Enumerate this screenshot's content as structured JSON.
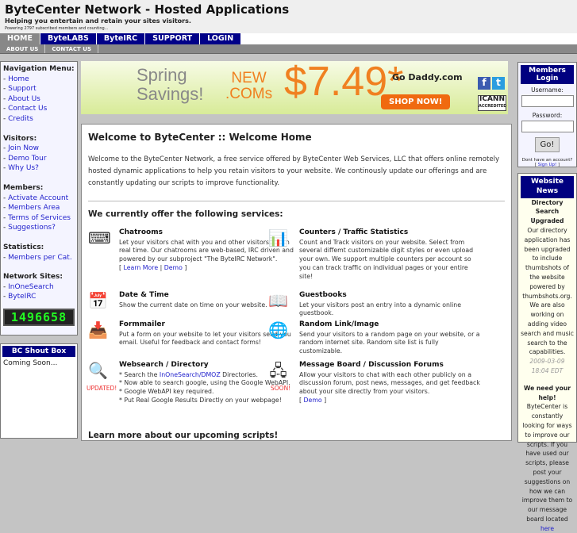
{
  "header": {
    "title": "ByteCenter Network - Hosted Applications",
    "tagline": "Helping you entertain and retain your sites visitors.",
    "powering": "Powering 2797 subscribed members and counting..."
  },
  "nav": [
    "HOME",
    "ByteLABS",
    "ByteIRC",
    "SUPPORT",
    "LOGIN"
  ],
  "subnav": [
    "ABOUT US",
    "CONTACT US"
  ],
  "sidebar": {
    "sections": [
      {
        "heading": "Navigation Menu:",
        "links": [
          "Home",
          "Support",
          "About Us",
          "Contact Us",
          "Credits"
        ]
      },
      {
        "heading": "Visitors:",
        "links": [
          "Join Now",
          "Demo Tour",
          "Why Us?"
        ]
      },
      {
        "heading": "Members:",
        "links": [
          "Activate Account",
          "Members Area",
          "Terms of Services",
          "Suggestions?"
        ]
      },
      {
        "heading": "Statistics:",
        "links": [
          "Members per Cat."
        ]
      },
      {
        "heading": "Network Sites:",
        "links": [
          "InOneSearch",
          "ByteIRC"
        ]
      }
    ],
    "counter": "1496658",
    "shoutbox_title": "BC Shout Box",
    "shoutbox_text": "Coming Soon..."
  },
  "banner": {
    "line1": "Spring",
    "line2": "Savings!",
    "new1": "NEW",
    ".com": ".COMs",
    "price": "$7.49*",
    "brand": "Go Daddy.com",
    "cta": "SHOP NOW!",
    "icann1": "ICANN",
    "icann2": "ACCREDITED"
  },
  "main": {
    "title": "Welcome to ByteCenter :: Welcome Home",
    "intro": "Welcome to the ByteCenter Network, a free service offered by ByteCenter Web Services, LLC that offers online remotely hosted dynamic applications to help you retain visitors to your website. We continously update our offerings and are constantly updating our scripts to improve functionality.",
    "services_heading": "We currently offer the following services:",
    "chat": {
      "title": "Chatrooms",
      "desc": "Let your visitors chat with you and other visitors live in real time. Our chatrooms are web-based, IRC driven and powered by our subproject \"The ByteIRC Network\".",
      "learn": "Learn More",
      "demo": "Demo"
    },
    "counters": {
      "title": "Counters / Traffic Statistics",
      "desc": "Count and Track visitors on your website. Select from several diffemt customizable digit styles or even upload your own. We support multiple counters per account so you can track traffic on individual pages or your entire site!"
    },
    "date": {
      "title": "Date & Time",
      "desc": "Show the current date on time on your website."
    },
    "guest": {
      "title": "Guestbooks",
      "desc": "Let your visitors post an entry into a dynamic online guestbook."
    },
    "form": {
      "title": "Formmailer",
      "desc": "Put a form on your website to let your visitors send you email. Useful for feedback and contact forms!"
    },
    "random": {
      "title": "Random Link/Image",
      "desc": "Send your visitors to a random page on your website, or a random internet site. Random site list is fully customizable."
    },
    "search": {
      "title": "Websearch / Directory",
      "l1a": "* Search the ",
      "link": "InOneSearch/DMOZ",
      "l1b": " Directories.",
      "l2": "* Now able to search google, using the Google WebAPI.",
      "l3": "* Google WebAPI key required.",
      "l4": "* Put Real Google Results Directly on your webpage!",
      "badge": "UPDATED!"
    },
    "forum": {
      "title": "Message Board / Discussion Forums",
      "desc": "Allow your visitors to chat with each other publicly on a discussion forum, post news, messages, and get feedback about your site directly from your visitors.",
      "demo": "Demo",
      "badge": "SOON!"
    },
    "more": "Learn more about our upcoming scripts!"
  },
  "login": {
    "title": "Members Login",
    "username": "Username:",
    "password": "Password:",
    "go": "Go!",
    "noacct": "Dont have an account?",
    "signup": "Sign Up!"
  },
  "news": {
    "title": "Website News",
    "h1": "Directory Search Upgraded",
    "p1": "Our directory application has been upgraded to include thumbshots of the website powered by thumbshots.org. We are also working on adding video search and music search to the capabilities.",
    "date": "2009-03-09 18:04 EDT",
    "h2": "We need your help!",
    "p2": "ByteCenter is constantly looking for ways to improve our scripts. If you have used our scripts, please post your suggestions on how we can improve them to our message board located ",
    "here": "here"
  }
}
